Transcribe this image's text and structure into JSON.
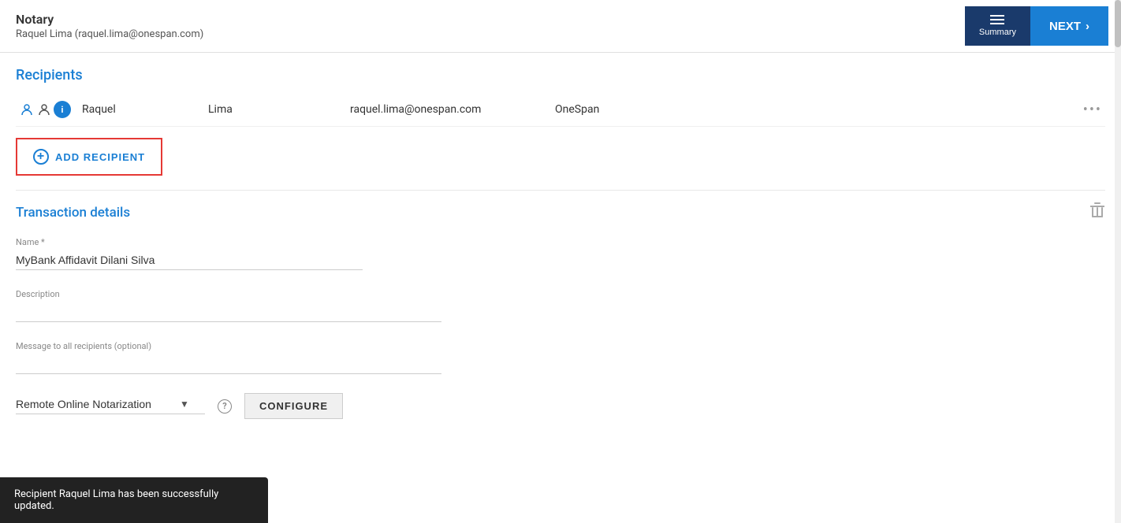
{
  "header": {
    "title": "Notary",
    "subtitle": "Raquel Lima (raquel.lima@onespan.com)",
    "summary_label": "Summary",
    "next_label": "NEXT"
  },
  "recipients_section": {
    "title": "Recipients",
    "recipient": {
      "first_name": "Raquel",
      "last_name": "Lima",
      "email": "raquel.lima@onespan.com",
      "org": "OneSpan"
    },
    "add_button_label": "ADD RECIPIENT"
  },
  "transaction_section": {
    "title": "Transaction details",
    "name_label": "Name *",
    "name_value": "MyBank Affidavit Dilani Silva",
    "description_label": "Description",
    "description_value": "",
    "message_label": "Message to all recipients (optional)",
    "message_value": ""
  },
  "bottom": {
    "dropdown_value": "Remote Online Notarization",
    "dropdown_options": [
      "Remote Online Notarization"
    ],
    "configure_label": "CONFIGURE"
  },
  "toast": {
    "message": "Recipient Raquel Lima has been successfully updated."
  },
  "icons": {
    "person": "👤",
    "person2": "🧑",
    "info_circle": "ℹ",
    "more": "•••",
    "trash": "🗑",
    "chevron_down": "▾"
  }
}
